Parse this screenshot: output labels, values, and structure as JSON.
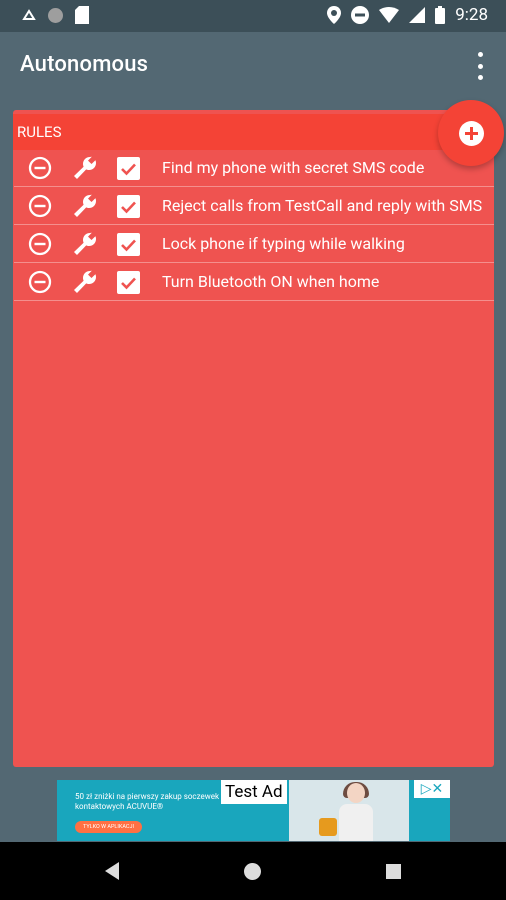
{
  "status": {
    "time": "9:28"
  },
  "appbar": {
    "title": "Autonomous"
  },
  "panel": {
    "header_label": "RULES"
  },
  "rules": [
    {
      "label": "Find my phone with secret SMS code",
      "enabled": true
    },
    {
      "label": "Reject calls from TestCall and reply with SMS",
      "enabled": true
    },
    {
      "label": "Lock phone if typing while walking",
      "enabled": true
    },
    {
      "label": "Turn Bluetooth ON when home",
      "enabled": true
    }
  ],
  "ad": {
    "label": "Test Ad",
    "copy": "50 zł zniżki na pierwszy zakup soczewek kontaktowych ACUVUE®",
    "cta": "TYLKO W APLIKACJI",
    "corner": "▷✕"
  },
  "colors": {
    "panel": "#ef5350",
    "header": "#f44336",
    "appbar": "#536873"
  }
}
